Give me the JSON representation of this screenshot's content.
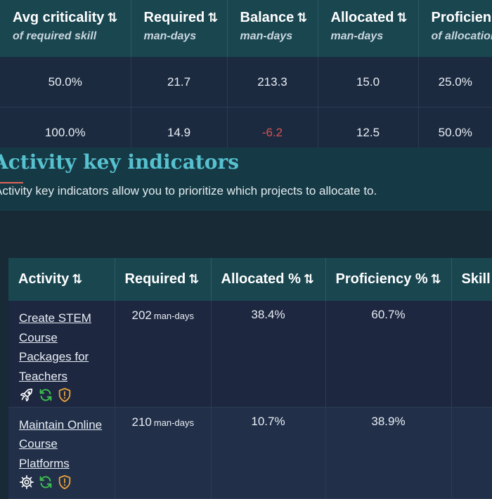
{
  "summary_table": {
    "headers": [
      {
        "title": "Avg criticality",
        "sort": "⇅",
        "subtitle": "of required skill"
      },
      {
        "title": "Required",
        "sort": "⇅",
        "subtitle": "man-days"
      },
      {
        "title": "Balance",
        "sort": "⇅",
        "subtitle": "man-days"
      },
      {
        "title": "Allocated",
        "sort": "⇅",
        "subtitle": "man-days"
      },
      {
        "title": "Proficiency",
        "sort": "",
        "subtitle": "of allocation"
      }
    ],
    "rows": [
      {
        "avg_criticality": "50.0%",
        "required": "21.7",
        "balance": "213.3",
        "allocated": "15.0",
        "proficiency": "25.0%"
      },
      {
        "avg_criticality": "100.0%",
        "required": "14.9",
        "balance": "-6.2",
        "allocated": "12.5",
        "proficiency": "50.0%"
      }
    ]
  },
  "section": {
    "title": "Activity key indicators",
    "description": "Activity key indicators allow you to prioritize which projects to allocate to."
  },
  "activity_table": {
    "headers": {
      "activity": "Activity",
      "required": "Required",
      "allocated": "Allocated %",
      "proficiency": "Proficiency %",
      "skill": "Skill",
      "sort": "⇅"
    },
    "rows": [
      {
        "name": "Create STEM Course Packages for Teachers",
        "required": "202",
        "unit": "man-days",
        "allocated": "38.4%",
        "proficiency": "60.7%",
        "icons": [
          "rocket-icon",
          "refresh-icon",
          "warning-shield-icon"
        ]
      },
      {
        "name": "Maintain Online Course Platforms",
        "required": "210",
        "unit": "man-days",
        "allocated": "10.7%",
        "proficiency": "38.9%",
        "icons": [
          "gear-icon",
          "refresh-icon",
          "warning-shield-icon"
        ]
      }
    ]
  },
  "colors": {
    "header_bg": "#1a4650",
    "section_title": "#56c1cf",
    "negative": "#d9534f",
    "icon_green": "#3fbf4f",
    "icon_orange": "#e8a13a"
  }
}
